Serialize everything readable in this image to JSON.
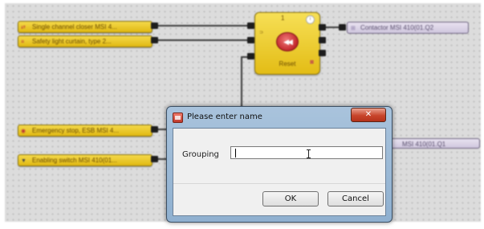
{
  "diagram": {
    "inputs": [
      {
        "label": "Single channel closer MSI 4..."
      },
      {
        "label": "Safety light curtain, type 2..."
      },
      {
        "label": "Emergency stop, ESB MSI 4..."
      },
      {
        "label": "Enabling switch MSI 410(01..."
      }
    ],
    "outputs": [
      {
        "label": "Contactor MSI 410(01.Q2"
      },
      {
        "label": "MSI 410(01.Q1"
      }
    ],
    "reset_block": {
      "number": "1",
      "label": "Reset",
      "button_symbol": "◀◀"
    }
  },
  "dialog": {
    "title": "Please enter name",
    "close_symbol": "✕",
    "field_label": "Grouping",
    "field_value": "",
    "ok_label": "OK",
    "cancel_label": "Cancel"
  }
}
